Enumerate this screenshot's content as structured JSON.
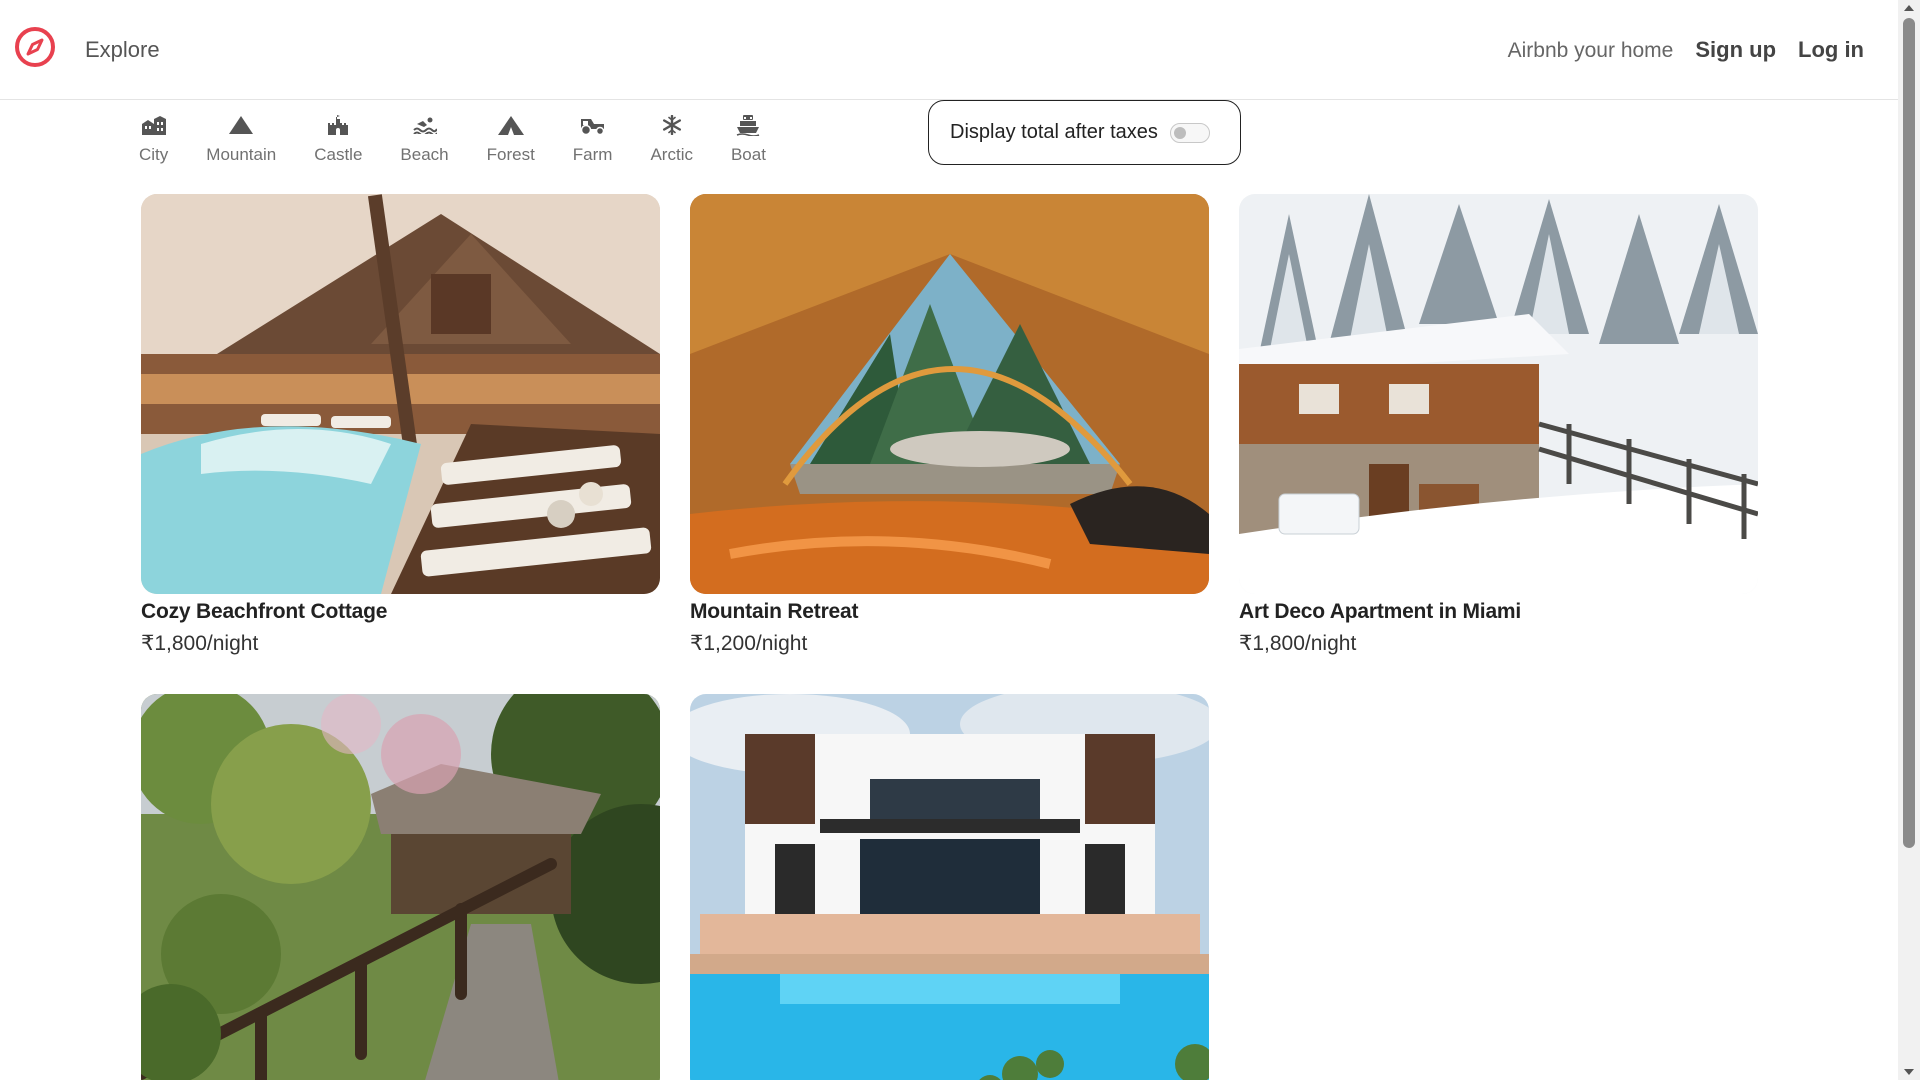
{
  "nav": {
    "explore": "Explore",
    "host": "Airbnb your home",
    "signup": "Sign up",
    "login": "Log in",
    "brand_color": "#e8414f"
  },
  "filters": [
    {
      "label": "City",
      "icon": "city-icon"
    },
    {
      "label": "Mountain",
      "icon": "mountain-icon"
    },
    {
      "label": "Castle",
      "icon": "castle-icon"
    },
    {
      "label": "Beach",
      "icon": "beach-swimmer-icon"
    },
    {
      "label": "Forest",
      "icon": "forest-tent-icon"
    },
    {
      "label": "Farm",
      "icon": "farm-tractor-icon"
    },
    {
      "label": "Arctic",
      "icon": "snowflake-icon"
    },
    {
      "label": "Boat",
      "icon": "ship-icon"
    }
  ],
  "tax_toggle": {
    "label": "Display total after taxes",
    "enabled": false
  },
  "listings": [
    {
      "title": "Cozy Beachfront Cottage",
      "price": "₹1,800/night",
      "image": "resort-pool-cottage-photo"
    },
    {
      "title": "Mountain Retreat",
      "price": "₹1,200/night",
      "image": "tent-forest-view-photo"
    },
    {
      "title": "Art Deco Apartment in Miami",
      "price": "₹1,800/night",
      "image": "snowy-chalet-photo"
    },
    {
      "title": "",
      "price": "",
      "image": "garden-path-cabin-photo"
    },
    {
      "title": "",
      "price": "",
      "image": "modern-villa-pool-photo"
    }
  ]
}
